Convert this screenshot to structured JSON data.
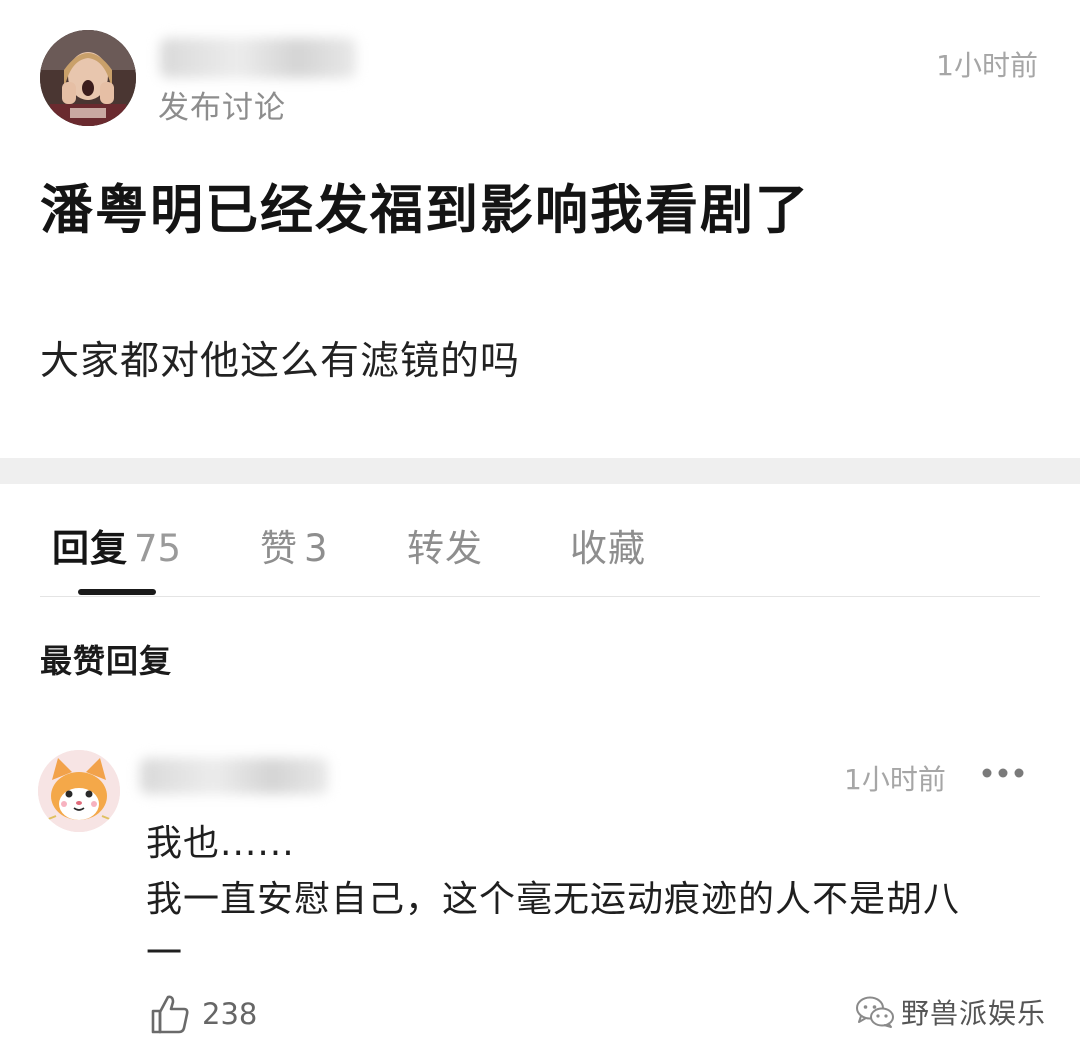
{
  "post": {
    "subtitle": "发布讨论",
    "time": "1小时前",
    "title": "潘粤明已经发福到影响我看剧了",
    "body": "大家都对他这么有滤镜的吗"
  },
  "tabs": [
    {
      "label": "回复",
      "count": "75",
      "active": true
    },
    {
      "label": "赞",
      "count": "3",
      "active": false
    },
    {
      "label": "转发",
      "count": "",
      "active": false
    },
    {
      "label": "收藏",
      "count": "",
      "active": false
    }
  ],
  "section_heading": "最赞回复",
  "reply": {
    "time": "1小时前",
    "lines": [
      "我也......",
      "我一直安慰自己，这个毫无运动痕迹的人不是胡八",
      "一"
    ],
    "likes": "238"
  },
  "watermark": {
    "text": "野兽派娱乐"
  },
  "icons": {
    "more": "more-dots-icon",
    "like": "thumbs-up-icon",
    "watermark": "wechat-icon"
  },
  "colors": {
    "tab_indicator": "#1a1a1a",
    "section_divider": "#efefef",
    "muted_text": "#a6a6a6"
  }
}
